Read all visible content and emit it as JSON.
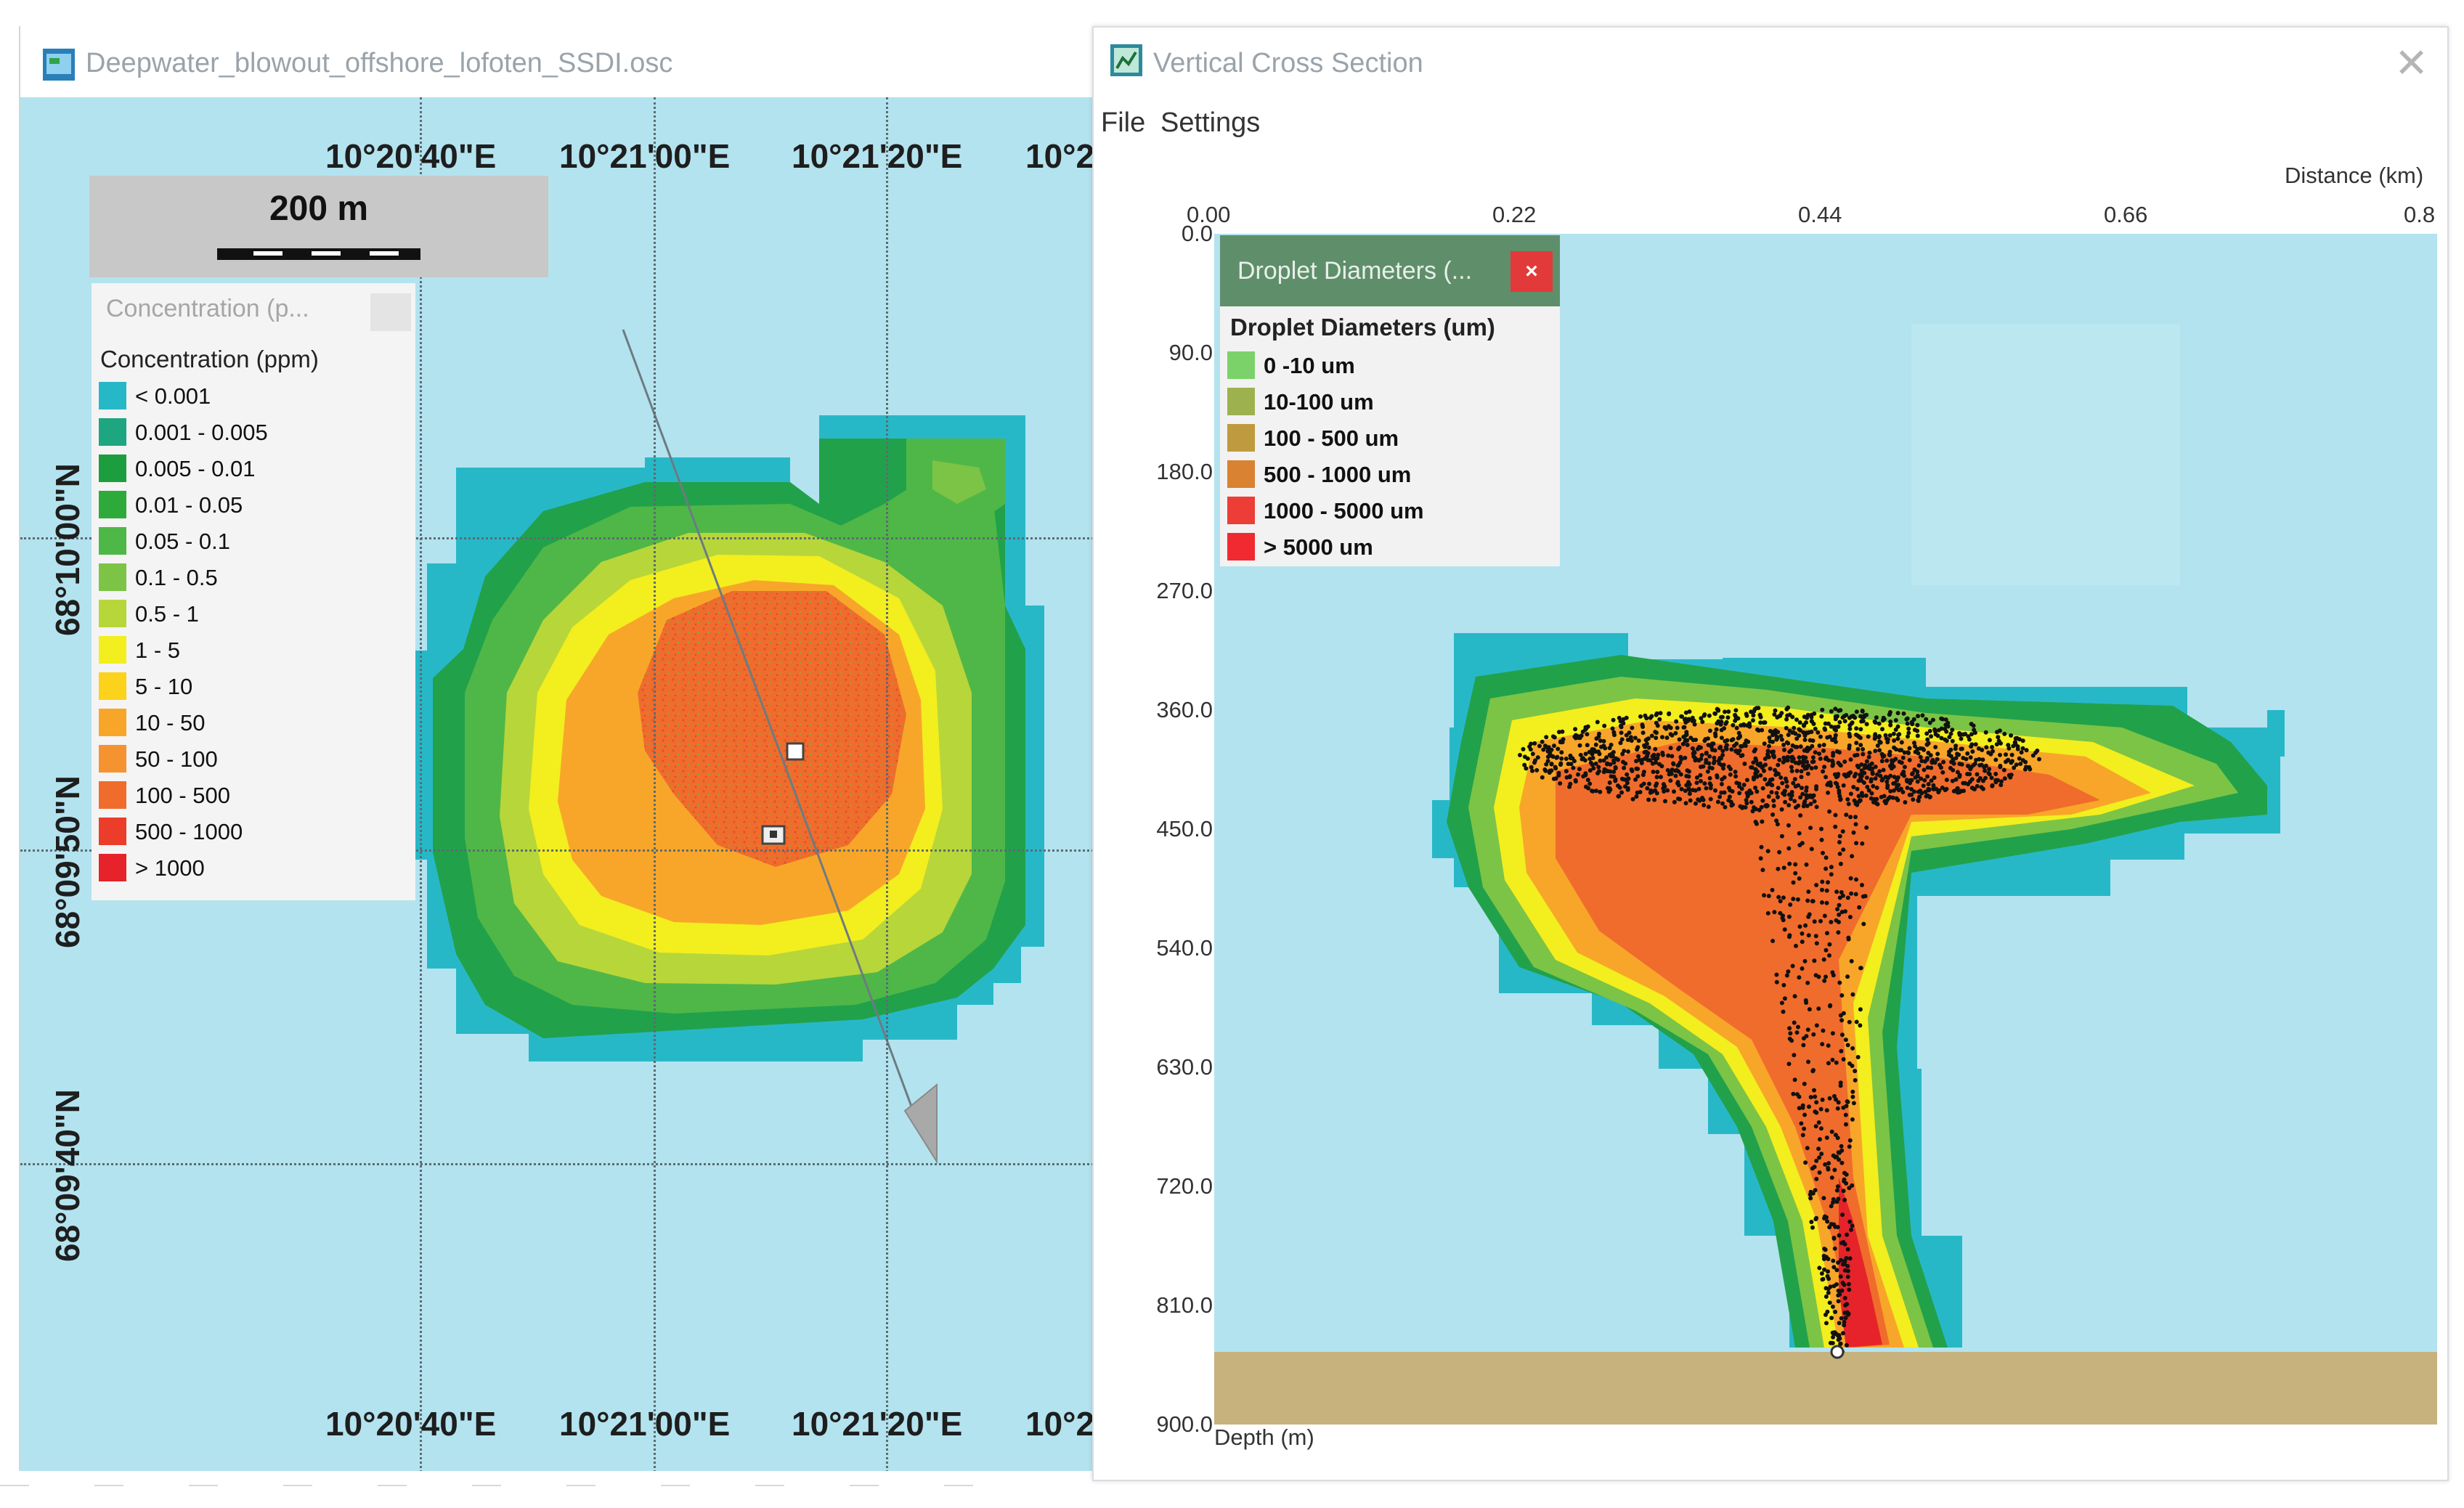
{
  "map_window": {
    "title": "Deepwater_blowout_offshore_lofoten_SSDI.osc",
    "coords_top": [
      "10°20'40\"E",
      "10°21'00\"E",
      "10°21'20\"E",
      "10°2"
    ],
    "coords_bottom": [
      "10°20'40\"E",
      "10°21'00\"E",
      "10°21'20\"E",
      "10°2"
    ],
    "coords_left": [
      "68°10'00\"N",
      "68°09'50\"N",
      "68°09'40\"N"
    ],
    "scale_label": "200 m",
    "legend": {
      "tab_title": "Concentration (p...",
      "title": "Concentration (ppm)",
      "items": [
        {
          "label": "< 0.001",
          "color": "#27b8c8"
        },
        {
          "label": "0.001 - 0.005",
          "color": "#1da67f"
        },
        {
          "label": "0.005 - 0.01",
          "color": "#1c9e3e"
        },
        {
          "label": "0.01 - 0.05",
          "color": "#2eaa3a"
        },
        {
          "label": "0.05 - 0.1",
          "color": "#4db848"
        },
        {
          "label": "0.1 - 0.5",
          "color": "#7cc445"
        },
        {
          "label": "0.5 - 1",
          "color": "#b7d63a"
        },
        {
          "label": "1 - 5",
          "color": "#f3ee1e"
        },
        {
          "label": "5 - 10",
          "color": "#fcd21c"
        },
        {
          "label": "10 - 50",
          "color": "#f8a62a"
        },
        {
          "label": "50 - 100",
          "color": "#f59330"
        },
        {
          "label": "100 - 500",
          "color": "#f06c2c"
        },
        {
          "label": "500 - 1000",
          "color": "#ec3c2a"
        },
        {
          "label": "> 1000",
          "color": "#e6232a"
        }
      ]
    }
  },
  "vcs_window": {
    "title": "Vertical Cross Section",
    "menu": [
      "File",
      "Settings"
    ],
    "x_axis_title": "Distance (km)",
    "x_ticks": [
      "0.00",
      "0.22",
      "0.44",
      "0.66",
      "0.8"
    ],
    "y_axis_title": "Depth (m)",
    "y_ticks": [
      "0.0",
      "90.0",
      "180.0",
      "270.0",
      "360.0",
      "450.0",
      "540.0",
      "630.0",
      "720.0",
      "810.0",
      "900.0"
    ],
    "droplet_legend": {
      "tab_title": "Droplet Diameters (...",
      "close_label": "×",
      "title": "Droplet Diameters (um)",
      "items": [
        {
          "label": "0 -10 um",
          "color": "#7cd26a"
        },
        {
          "label": "10-100 um",
          "color": "#9db24e"
        },
        {
          "label": "100 - 500 um",
          "color": "#bf9a3e"
        },
        {
          "label": "500 - 1000 um",
          "color": "#d98232"
        },
        {
          "label": "1000 - 5000 um",
          "color": "#ec3d36"
        },
        {
          "label": "> 5000 um",
          "color": "#f02a30"
        }
      ]
    },
    "seabed_color": "#c7b27e"
  }
}
